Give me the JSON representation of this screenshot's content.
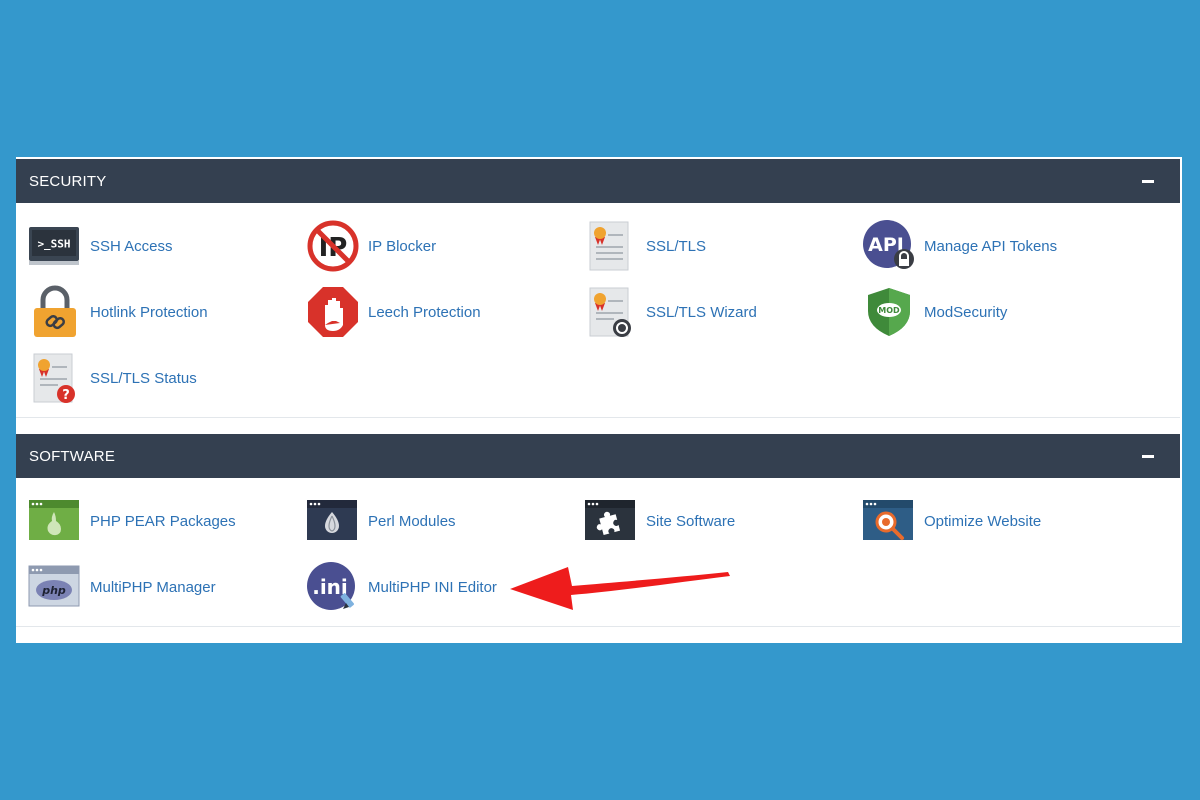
{
  "colors": {
    "background": "#3498cc",
    "header_bg": "#344050",
    "link": "#2d72b5",
    "arrow": "#ee1c1c"
  },
  "security": {
    "title": "SECURITY",
    "collapse_icon": "minus-icon",
    "items": [
      {
        "label": "SSH Access",
        "icon": "ssh-terminal-icon"
      },
      {
        "label": "IP Blocker",
        "icon": "ip-blocker-icon"
      },
      {
        "label": "SSL/TLS",
        "icon": "certificate-icon"
      },
      {
        "label": "Manage API Tokens",
        "icon": "api-lock-icon"
      },
      {
        "label": "Hotlink Protection",
        "icon": "padlock-link-icon"
      },
      {
        "label": "Leech Protection",
        "icon": "stop-hand-icon"
      },
      {
        "label": "SSL/TLS Wizard",
        "icon": "certificate-wizard-icon"
      },
      {
        "label": "ModSecurity",
        "icon": "mod-shield-icon"
      },
      {
        "label": "SSL/TLS Status",
        "icon": "certificate-status-icon"
      }
    ]
  },
  "software": {
    "title": "SOFTWARE",
    "collapse_icon": "minus-icon",
    "items": [
      {
        "label": "PHP PEAR Packages",
        "icon": "pear-window-icon"
      },
      {
        "label": "Perl Modules",
        "icon": "onion-window-icon"
      },
      {
        "label": "Site Software",
        "icon": "puzzle-window-icon"
      },
      {
        "label": "Optimize Website",
        "icon": "magnifier-window-icon"
      },
      {
        "label": "MultiPHP Manager",
        "icon": "php-window-icon"
      },
      {
        "label": "MultiPHP INI Editor",
        "icon": "ini-editor-icon"
      }
    ]
  },
  "annotation": {
    "icon": "red-arrow-icon"
  }
}
